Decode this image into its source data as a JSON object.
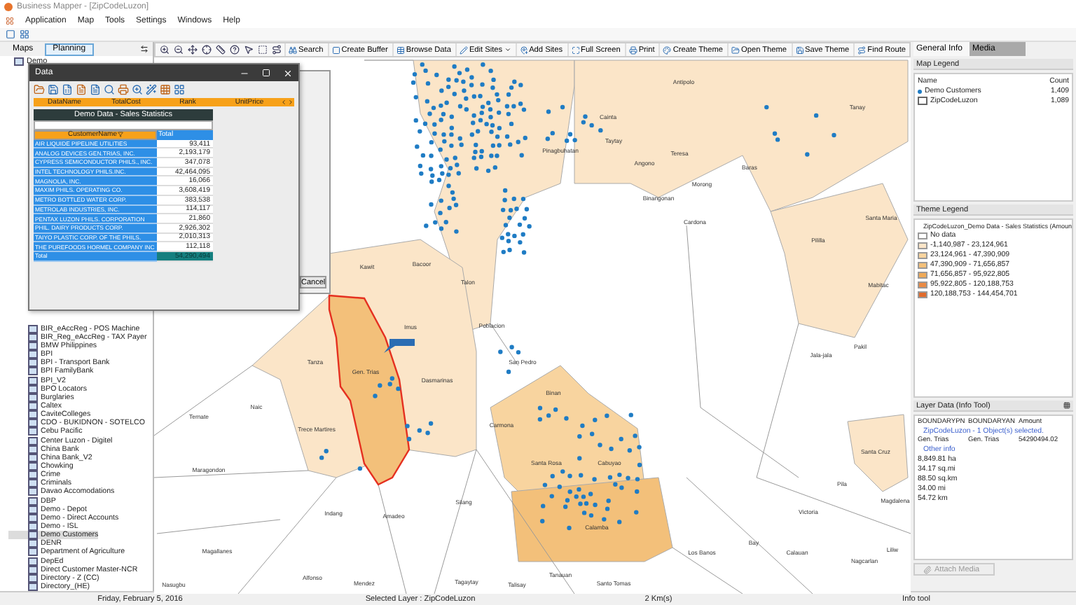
{
  "window": {
    "title": "Business Mapper - [ZipCodeLuzon]"
  },
  "menu": [
    "Application",
    "Map",
    "Tools",
    "Settings",
    "Windows",
    "Help"
  ],
  "sidebar": {
    "tabs": [
      {
        "label": "Maps",
        "selected": false
      },
      {
        "label": "Planning",
        "selected": true
      }
    ],
    "root": "Demo",
    "items": [
      {
        "label": "BIR_eAccReg - POS Machine",
        "selected": false
      },
      {
        "label": "BIR_Reg_eAccReg - TAX Payer",
        "selected": false
      },
      {
        "label": "BMW Philippines",
        "selected": false
      },
      {
        "label": "BPI",
        "selected": false
      },
      {
        "label": "BPI - Transport Bank",
        "selected": false
      },
      {
        "label": "BPI FamilyBank",
        "selected": false
      },
      {
        "label": "BPI_V2",
        "selected": false
      },
      {
        "label": "BPO Locators",
        "selected": false
      },
      {
        "label": "Burglaries",
        "selected": false
      },
      {
        "label": "Caltex",
        "selected": false
      },
      {
        "label": "CaviteColleges",
        "selected": false
      },
      {
        "label": "CDO - BUKIDNON - SOTELCO",
        "selected": false
      },
      {
        "label": "Cebu Pacific",
        "selected": false
      },
      {
        "label": "Center Luzon - Digitel",
        "selected": false
      },
      {
        "label": "China Bank",
        "selected": false
      },
      {
        "label": "China Bank_V2",
        "selected": false
      },
      {
        "label": "Chowking",
        "selected": false
      },
      {
        "label": "Crime",
        "selected": false
      },
      {
        "label": "Criminals",
        "selected": false
      },
      {
        "label": "Davao Accomodations",
        "selected": false
      },
      {
        "label": "DBP",
        "selected": false
      },
      {
        "label": "Demo - Depot",
        "selected": false
      },
      {
        "label": "Demo - Direct Accounts",
        "selected": false
      },
      {
        "label": "Demo - ISL",
        "selected": false
      },
      {
        "label": "Demo Customers",
        "selected": true
      },
      {
        "label": "DENR",
        "selected": false
      },
      {
        "label": "Department of Agriculture",
        "selected": false
      },
      {
        "label": "DepEd",
        "selected": false
      },
      {
        "label": "Direct Customer Master-NCR",
        "selected": false
      },
      {
        "label": "Directory - Z (CC)",
        "selected": false
      },
      {
        "label": "Directory_(HE)",
        "selected": false
      }
    ]
  },
  "toolbar": {
    "buttons": [
      {
        "label": "Search",
        "dropdown": false
      },
      {
        "label": "Create Buffer",
        "dropdown": false
      },
      {
        "label": "Browse Data",
        "dropdown": false
      },
      {
        "label": "Edit Sites",
        "dropdown": true
      },
      {
        "label": "Add Sites",
        "dropdown": false
      },
      {
        "label": "Full Screen",
        "dropdown": false
      },
      {
        "label": "Print",
        "dropdown": false
      },
      {
        "label": "Create Theme",
        "dropdown": false
      },
      {
        "label": "Open Theme",
        "dropdown": false
      },
      {
        "label": "Save Theme",
        "dropdown": false
      },
      {
        "label": "Find Route",
        "dropdown": false
      }
    ]
  },
  "dialog": {
    "button": "Cancel"
  },
  "data_window": {
    "title": "Data",
    "fields": [
      "DataName",
      "TotalCost",
      "Rank",
      "UnitPrice"
    ],
    "table_title": "Demo Data - Sales Statistics",
    "columns": [
      "CustomerName",
      "Total"
    ],
    "rows": [
      [
        "AIR LIQUIDE PIPELINE UTILITIES",
        "93,411"
      ],
      [
        "ANALOG DEVICES GEN.TRIAS, INC.",
        "2,193,179"
      ],
      [
        "CYPRESS SEMICONDUCTOR PHILS., INC.",
        "347,078"
      ],
      [
        "INTEL TECHNOLOGY PHILS.INC.",
        "42,464,095"
      ],
      [
        "MAGNOLIA, INC.",
        "16,066"
      ],
      [
        "MAXIM PHILS. OPERATING CO.",
        "3,608,419"
      ],
      [
        "METRO BOTTLED WATER CORP.",
        "383,538"
      ],
      [
        "METROLAB INDUSTRIES, INC.",
        "114,117"
      ],
      [
        "PENTAX LUZON PHILS. CORPORATION",
        "21,860"
      ],
      [
        "PHIL. DAIRY PRODUCTS CORP.",
        "2,926,302"
      ],
      [
        "TAIYO PLASTIC CORP. OF THE PHILS.",
        "2,010,313"
      ],
      [
        "THE PUREFOODS HORMEL COMPANY INC",
        "112,118"
      ]
    ],
    "total": [
      "Total",
      "54,290,494"
    ]
  },
  "map": {
    "labels": [
      "Antipolo",
      "Tanay",
      "Cainta",
      "Taytay",
      "Teresa",
      "Angono",
      "Baras",
      "Morong",
      "Binangonan",
      "Cardona",
      "Santa Maria",
      "Pililla",
      "Mabitac",
      "Pinagbuhatan",
      "Bacoor",
      "Kawit",
      "Talon",
      "Imus",
      "Poblacion",
      "Tanza",
      "Gen. Trias",
      "San Pedro",
      "Jala-jala",
      "Pakil",
      "Dasmarinas",
      "Binan",
      "Naic",
      "Ternate",
      "Carmona",
      "Trece Martires",
      "Santa Cruz",
      "Santa Rosa",
      "Cabuyao",
      "Maragondon",
      "Pila",
      "Magdalena",
      "Silang",
      "Victoria",
      "Indang",
      "Amadeo",
      "Calamba",
      "Bay",
      "Magallanes",
      "Los Banos",
      "Calauan",
      "Nagcarlan",
      "Liliw",
      "Tanauan",
      "Alfonso",
      "Mendez",
      "Tagaytay",
      "Nasugbu",
      "Talisay",
      "Santo Tomas"
    ]
  },
  "right_panel": {
    "tabs": [
      {
        "label": "General Info",
        "selected": true
      },
      {
        "label": "Media",
        "selected": false
      }
    ],
    "map_legend": {
      "title": "Map Legend",
      "columns": [
        "Name",
        "Count"
      ],
      "rows": [
        {
          "kind": "point",
          "name": "Demo Customers",
          "count": "1,409"
        },
        {
          "kind": "polygon",
          "name": "ZipCodeLuzon",
          "count": "1,089"
        }
      ]
    },
    "theme_legend": {
      "title": "Theme Legend",
      "heading": "ZipCodeLuzon_Demo Data - Sales Statistics (Amoun",
      "items": [
        {
          "label": "No data",
          "color": "#ffffff"
        },
        {
          "label": "-1,140,987 - 23,124,961",
          "color": "#fbe5c8"
        },
        {
          "label": "23,124,961 - 47,390,909",
          "color": "#f8d49f"
        },
        {
          "label": "47,390,909 - 71,656,857",
          "color": "#f3c07a"
        },
        {
          "label": "71,656,857 - 95,922,805",
          "color": "#efa957"
        },
        {
          "label": "95,922,805 - 120,188,753",
          "color": "#e98a44"
        },
        {
          "label": "120,188,753 - 144,454,701",
          "color": "#e06b2c"
        }
      ]
    },
    "layer_data": {
      "title": "Layer Data (Info Tool)",
      "columns": [
        "BOUNDARYPN",
        "BOUNDARYAN",
        "Amount"
      ],
      "selection": "ZipCodeLuzon - 1 Object(s) selected.",
      "row": [
        "Gen. Trias",
        "Gen. Trias",
        "54290494.02"
      ],
      "other_title": "Other info",
      "other": [
        "8,849.81 ha",
        "34.17 sq.mi",
        "88.50 sq.km",
        "34.00 mi",
        "54.72 km"
      ]
    },
    "attach_button": {
      "label": "Attach Media",
      "disabled": true
    }
  },
  "status_bar": [
    "Friday, February 5, 2016",
    "Selected Layer : ZipCodeLuzon",
    "2 Km(s)",
    "Info tool"
  ]
}
